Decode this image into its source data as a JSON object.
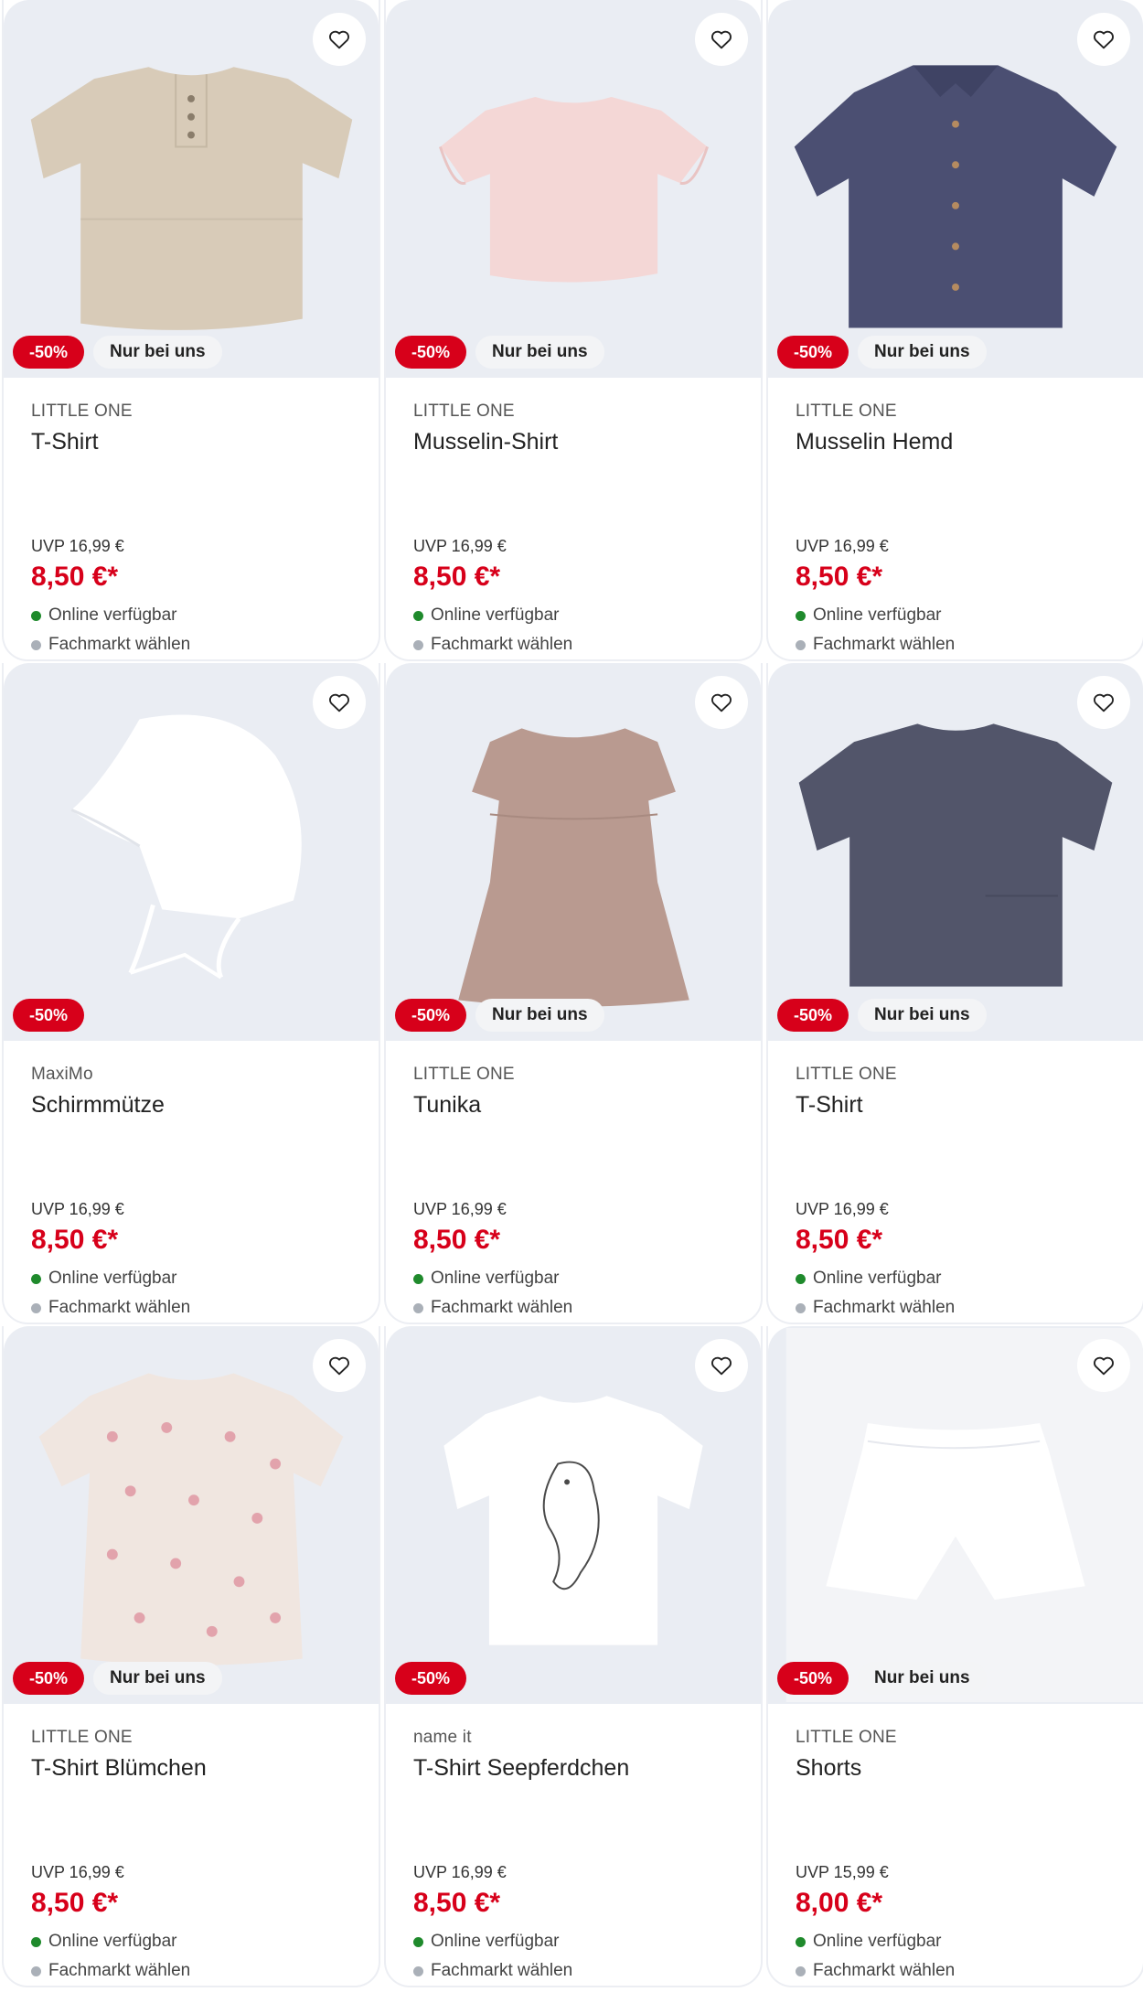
{
  "colors": {
    "accent_red": "#d7001a",
    "available_green": "#1f8a2c",
    "store_gray": "#aab0b8",
    "image_bg": "#eaedf3"
  },
  "products": [
    {
      "brand": "LITTLE ONE",
      "name": "T-Shirt",
      "uvp": "UVP 16,99 €",
      "price": "8,50 €*",
      "discount": "-50%",
      "exclusive": "Nur bei uns",
      "online": "Online verfügbar",
      "store": "Fachmarkt wählen",
      "image": "beige-henley-tshirt",
      "wishlist_icon": "heart-icon"
    },
    {
      "brand": "LITTLE ONE",
      "name": "Musselin-Shirt",
      "uvp": "UVP 16,99 €",
      "price": "8,50 €*",
      "discount": "-50%",
      "exclusive": "Nur bei uns",
      "online": "Online verfügbar",
      "store": "Fachmarkt wählen",
      "image": "pink-ruffle-shirt",
      "wishlist_icon": "heart-icon"
    },
    {
      "brand": "LITTLE ONE",
      "name": "Musselin Hemd",
      "uvp": "UVP 16,99 €",
      "price": "8,50 €*",
      "discount": "-50%",
      "exclusive": "Nur bei uns",
      "online": "Online verfügbar",
      "store": "Fachmarkt wählen",
      "image": "navy-button-shirt",
      "wishlist_icon": "heart-icon"
    },
    {
      "brand": "MaxiMo",
      "name": "Schirmmütze",
      "uvp": "UVP 16,99 €",
      "price": "8,50 €*",
      "discount": "-50%",
      "exclusive": "",
      "online": "Online verfügbar",
      "store": "Fachmarkt wählen",
      "image": "white-cap",
      "wishlist_icon": "heart-icon"
    },
    {
      "brand": "LITTLE ONE",
      "name": "Tunika",
      "uvp": "UVP 16,99 €",
      "price": "8,50 €*",
      "discount": "-50%",
      "exclusive": "Nur bei uns",
      "online": "Online verfügbar",
      "store": "Fachmarkt wählen",
      "image": "mauve-tunic",
      "wishlist_icon": "heart-icon"
    },
    {
      "brand": "LITTLE ONE",
      "name": "T-Shirt",
      "uvp": "UVP 16,99 €",
      "price": "8,50 €*",
      "discount": "-50%",
      "exclusive": "Nur bei uns",
      "online": "Online verfügbar",
      "store": "Fachmarkt wählen",
      "image": "gray-tshirt",
      "wishlist_icon": "heart-icon"
    },
    {
      "brand": "LITTLE ONE",
      "name": "T-Shirt Blümchen",
      "uvp": "UVP 16,99 €",
      "price": "8,50 €*",
      "discount": "-50%",
      "exclusive": "Nur bei uns",
      "online": "Online verfügbar",
      "store": "Fachmarkt wählen",
      "image": "floral-tshirt",
      "wishlist_icon": "heart-icon"
    },
    {
      "brand": "name it",
      "name": "T-Shirt Seepferdchen",
      "uvp": "UVP 16,99 €",
      "price": "8,50 €*",
      "discount": "-50%",
      "exclusive": "",
      "online": "Online verfügbar",
      "store": "Fachmarkt wählen",
      "image": "seahorse-tshirt",
      "wishlist_icon": "heart-icon"
    },
    {
      "brand": "LITTLE ONE",
      "name": "Shorts",
      "uvp": "UVP 15,99 €",
      "price": "8,00 €*",
      "discount": "-50%",
      "exclusive": "Nur bei uns",
      "online": "Online verfügbar",
      "store": "Fachmarkt wählen",
      "image": "white-shorts",
      "wishlist_icon": "heart-icon"
    }
  ]
}
